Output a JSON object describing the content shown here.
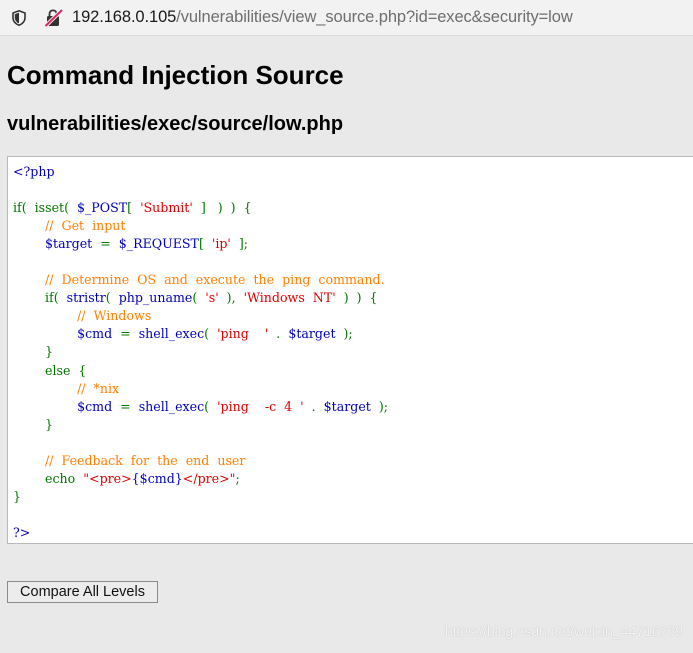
{
  "browser": {
    "url_host": "192.168.0.105",
    "url_path": "/vulnerabilities/view_source.php?id=exec&security=low",
    "icons": [
      "shield-icon",
      "insecure-lock-icon"
    ]
  },
  "page": {
    "title": "Command Injection Source",
    "file_path": "vulnerabilities/exec/source/low.php"
  },
  "source": {
    "colors": {
      "default": "#0000bb",
      "keyword": "#007700",
      "string": "#dd0000",
      "comment": "#ff8000"
    },
    "lines": [
      [
        [
          "d",
          "<?php"
        ]
      ],
      [],
      [
        [
          "k",
          "if(  "
        ],
        [
          "k",
          "isset(  "
        ],
        [
          "d",
          "$_POST"
        ],
        [
          "k",
          "[  "
        ],
        [
          "s",
          "'Submit'"
        ],
        [
          "k",
          "  ]   )  )  {"
        ]
      ],
      [
        [
          "k",
          "        "
        ],
        [
          "c",
          "//  Get  input"
        ]
      ],
      [
        [
          "k",
          "        "
        ],
        [
          "d",
          "$target"
        ],
        [
          "k",
          "  =  "
        ],
        [
          "d",
          "$_REQUEST"
        ],
        [
          "k",
          "[  "
        ],
        [
          "s",
          "'ip'"
        ],
        [
          "k",
          "  ];"
        ]
      ],
      [],
      [
        [
          "k",
          "        "
        ],
        [
          "c",
          "//  Determine  OS  and  execute  the  ping  command."
        ]
      ],
      [
        [
          "k",
          "        if(  "
        ],
        [
          "d",
          "stristr"
        ],
        [
          "k",
          "(  "
        ],
        [
          "d",
          "php_uname"
        ],
        [
          "k",
          "(  "
        ],
        [
          "s",
          "'s'"
        ],
        [
          "k",
          "  ),  "
        ],
        [
          "s",
          "'Windows  NT'"
        ],
        [
          "k",
          "  )  )  {"
        ]
      ],
      [
        [
          "k",
          "                "
        ],
        [
          "c",
          "//  Windows"
        ]
      ],
      [
        [
          "k",
          "                "
        ],
        [
          "d",
          "$cmd"
        ],
        [
          "k",
          "  =  "
        ],
        [
          "d",
          "shell_exec"
        ],
        [
          "k",
          "(  "
        ],
        [
          "s",
          "'ping    '"
        ],
        [
          "k",
          "  .  "
        ],
        [
          "d",
          "$target"
        ],
        [
          "k",
          "  );"
        ]
      ],
      [
        [
          "k",
          "        }"
        ]
      ],
      [
        [
          "k",
          "        else  {"
        ]
      ],
      [
        [
          "k",
          "                "
        ],
        [
          "c",
          "//  *nix"
        ]
      ],
      [
        [
          "k",
          "                "
        ],
        [
          "d",
          "$cmd"
        ],
        [
          "k",
          "  =  "
        ],
        [
          "d",
          "shell_exec"
        ],
        [
          "k",
          "(  "
        ],
        [
          "s",
          "'ping    -c  4  '"
        ],
        [
          "k",
          "  .  "
        ],
        [
          "d",
          "$target"
        ],
        [
          "k",
          "  );"
        ]
      ],
      [
        [
          "k",
          "        }"
        ]
      ],
      [],
      [
        [
          "k",
          "        "
        ],
        [
          "c",
          "//  Feedback  for  the  end  user"
        ]
      ],
      [
        [
          "k",
          "        echo  "
        ],
        [
          "s",
          "\"<pre>"
        ],
        [
          "d",
          "{$cmd}"
        ],
        [
          "s",
          "</pre>\""
        ],
        [
          "k",
          ";"
        ]
      ],
      [
        [
          "k",
          "}"
        ]
      ],
      [],
      [
        [
          "d",
          "?>"
        ]
      ]
    ]
  },
  "buttons": {
    "compare_label": "Compare All Levels"
  },
  "watermark": {
    "text": "https://blog.csdn.net/weixin_44716769"
  }
}
